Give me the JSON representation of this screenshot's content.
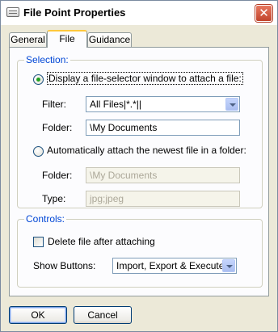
{
  "window": {
    "title": "File Point Properties",
    "close_glyph": "✕"
  },
  "tabs": [
    {
      "label": "General"
    },
    {
      "label": "File"
    },
    {
      "label": "Guidance"
    }
  ],
  "selection": {
    "label": "Selection:",
    "option1_label": "Display a file-selector window to attach a file:",
    "filter_label": "Filter:",
    "filter_value": "All Files|*.*||",
    "folder_label": "Folder:",
    "folder_value": "\\My Documents",
    "option2_label": "Automatically attach the newest file in a folder:",
    "folder2_label": "Folder:",
    "folder2_value": "\\My Documents",
    "type_label": "Type:",
    "type_value": "jpg;jpeg"
  },
  "controls": {
    "label": "Controls:",
    "delete_label": "Delete file after attaching",
    "show_buttons_label": "Show Buttons:",
    "show_buttons_value": "Import, Export & Execute"
  },
  "footer": {
    "ok_label": "OK",
    "cancel_label": "Cancel"
  },
  "icons": {
    "window_icon": "window-app-icon",
    "close": "close-icon",
    "dropdown": "chevron-down-icon"
  }
}
